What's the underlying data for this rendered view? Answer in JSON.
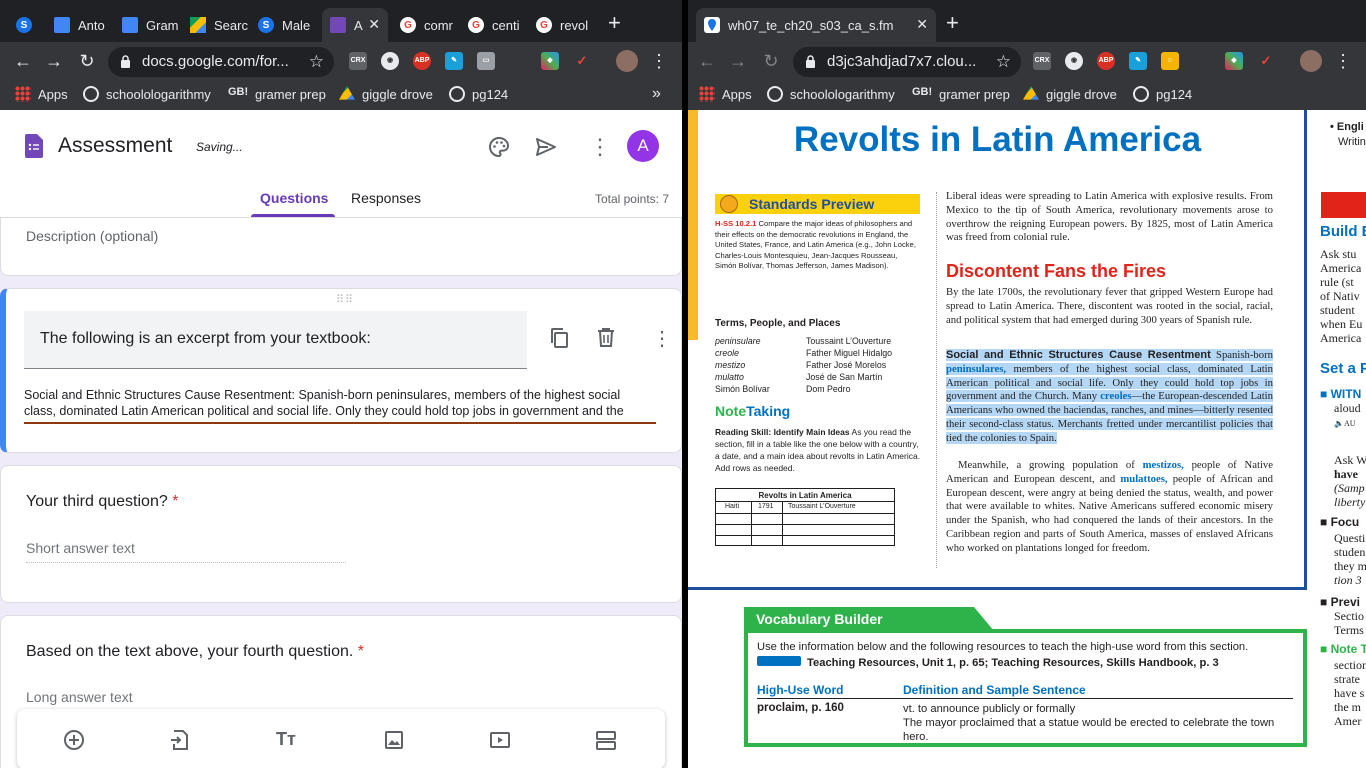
{
  "left_window": {
    "tabs": [
      {
        "label": "",
        "favicon": "S",
        "color": "#1a73e8"
      },
      {
        "label": "Anto",
        "favicon": "doc",
        "color": "#4285f4"
      },
      {
        "label": "Gram",
        "favicon": "doc",
        "color": "#4285f4"
      },
      {
        "label": "Searc",
        "favicon": "drive",
        "color": "#fbbc04"
      },
      {
        "label": "Male",
        "favicon": "S",
        "color": "#1a73e8"
      },
      {
        "label": "A",
        "favicon": "forms",
        "color": "#7248b9"
      },
      {
        "label": "comr",
        "favicon": "G",
        "color": "#ea4335"
      },
      {
        "label": "centi",
        "favicon": "G",
        "color": "#ea4335"
      },
      {
        "label": "revol",
        "favicon": "G",
        "color": "#ea4335"
      }
    ],
    "url": "docs.google.com/for...",
    "bookmarks": [
      "Apps",
      "schoolologarithmy",
      "gramer prep",
      "giggle drove",
      "pg124"
    ],
    "form": {
      "title": "Assessment",
      "status": "Saving...",
      "avatar_letter": "A",
      "tab_questions": "Questions",
      "tab_responses": "Responses",
      "total_points": "Total points: 7",
      "description_placeholder": "Description (optional)",
      "active_question_title": "The following is an excerpt from your textbook:",
      "active_question_body_line1": "Social and Ethnic Structures Cause Resentment: Spanish-born peninsulares, members of the highest social",
      "active_question_body_line2": "class, dominated Latin American political and social life. Only they could hold top jobs in government and the",
      "third_question": "Your third question?",
      "third_placeholder": "Short answer text",
      "fourth_question": "Based on the text above, your fourth question.",
      "fourth_placeholder": "Long answer text",
      "required_mark": "*"
    }
  },
  "right_window": {
    "tab_title": "wh07_te_ch20_s03_ca_s.fm",
    "url": "d3jc3ahdjad7x7.clou...",
    "bookmarks": [
      "Apps",
      "schoolologarithmy",
      "gramer prep",
      "giggle drove",
      "pg124"
    ],
    "textbook": {
      "title": "Revolts in Latin America",
      "standards_header": "Standards Preview",
      "standards_code": "H-SS 10.2.1",
      "standards_text": "Compare the major ideas of philosophers and their effects on the democratic revolutions in England, the United States, France, and Latin America (e.g., John Locke, Charles-Louis Montesquieu, Jean-Jacques Rousseau, Simón Bolívar, Thomas Jefferson, James Madison).",
      "terms_header": "Terms, People, and Places",
      "terms_col1": [
        "peninsulare",
        "creole",
        "mestizo",
        "mulatto",
        "Simón Bolívar"
      ],
      "terms_col2": [
        "Toussaint L’Ouverture",
        "Father Miguel Hidalgo",
        "Father José Morelos",
        "José de San Martín",
        "Dom Pedro"
      ],
      "note_taking_note": "Note",
      "note_taking_taking": "Taking",
      "reading_skill_label": "Reading Skill: Identify Main Ideas",
      "reading_skill_text": "As you read the section, fill in a table like the one below with a country, a date, and a main idea about revolts in Latin America. Add rows as needed.",
      "table_title": "Revolts in Latin America",
      "table_row": [
        "Haiti",
        "1791",
        "Toussaint L’Ouverture"
      ],
      "intro": "Liberal ideas were spreading to Latin America with explosive results. From Mexico to the tip of South America, revolutionary movements arose to overthrow the reigning European powers. By 1825, most of Latin America was freed from colonial rule.",
      "section_heading": "Discontent Fans the Fires",
      "para1": "By the late 1700s, the revolutionary fever that gripped Western Europe had spread to Latin America. There, discontent was rooted in the social, racial, and political system that had emerged during 300 years of Spanish rule.",
      "hl_head": "Social and Ethnic Structures Cause Resentment",
      "hl_a": " Spanish-born ",
      "hl_term1": "peninsulares,",
      "hl_b": " members of the highest social class, dominated Latin American political and social life. Only they could hold top jobs in government and the Church. Many ",
      "hl_term2": "creoles",
      "hl_c": "—the European-descended Latin Americans who owned the haciendas, ranches, and mines—bitterly resented their second-class status. Merchants fretted under mercantilist policies that tied the colonies to Spain.",
      "p3_a": "Meanwhile, a growing population of ",
      "p3_term1": "mestizos,",
      "p3_b": " people of Native American and European descent, and ",
      "p3_term2": "mulattoes,",
      "p3_c": " people of African and European descent, were angry at being denied the status, wealth, and power that were available to whites. Native Americans suffered economic misery under the Spanish, who had conquered the lands of their ancestors. In the Caribbean region and parts of South America, masses of enslaved Africans who worked on plantations longed for freedom.",
      "vocab_header": "Vocabulary Builder",
      "vocab_intro": "Use the information below and the following resources to teach the high-use word from this section.",
      "vocab_resources": "Teaching Resources, Unit 1, p. 65; Teaching Resources, Skills Handbook, p. 3",
      "vocab_col1": "High-Use Word",
      "vocab_col2": "Definition and Sample Sentence",
      "vocab_word": "proclaim, p. 160",
      "vocab_def": "vt. to announce publicly or formally",
      "vocab_sentence": "The mayor proclaimed that a statue would be erected to celebrate the town hero.",
      "sidebar_bullet": "• Engli",
      "sidebar_writ": "Writin",
      "sidebar_build": "Build B",
      "sidebar_ask": "Ask stu",
      "sidebar_lines": [
        "America",
        "rule (st",
        "of Nativ",
        "student",
        "when Eu",
        "America"
      ],
      "sidebar_set": "Set a P",
      "sidebar_witn": "WITN",
      "sidebar_aloud": "aloud",
      "sidebar_au": "AU",
      "sidebar_askw": "Ask W",
      "sidebar_have": "have",
      "sidebar_samp": "(Samp",
      "sidebar_liberty": "liberty",
      "sidebar_focu": "Focu",
      "sidebar_focus_lines": [
        "Questi",
        "studen",
        "they m",
        "tion 3"
      ],
      "sidebar_previ": "Previ",
      "sidebar_previ_lines": [
        "Sectio",
        "Terms"
      ],
      "sidebar_note": "Note T",
      "sidebar_note_lines": [
        "section",
        "strate",
        "have s",
        "the m",
        "Amer"
      ]
    }
  },
  "colors": {
    "purple": "#673ab7",
    "red": "#d93025",
    "textbook_blue": "#0070c0",
    "textbook_red": "#e2231a",
    "vocab_green": "#2db34a"
  }
}
